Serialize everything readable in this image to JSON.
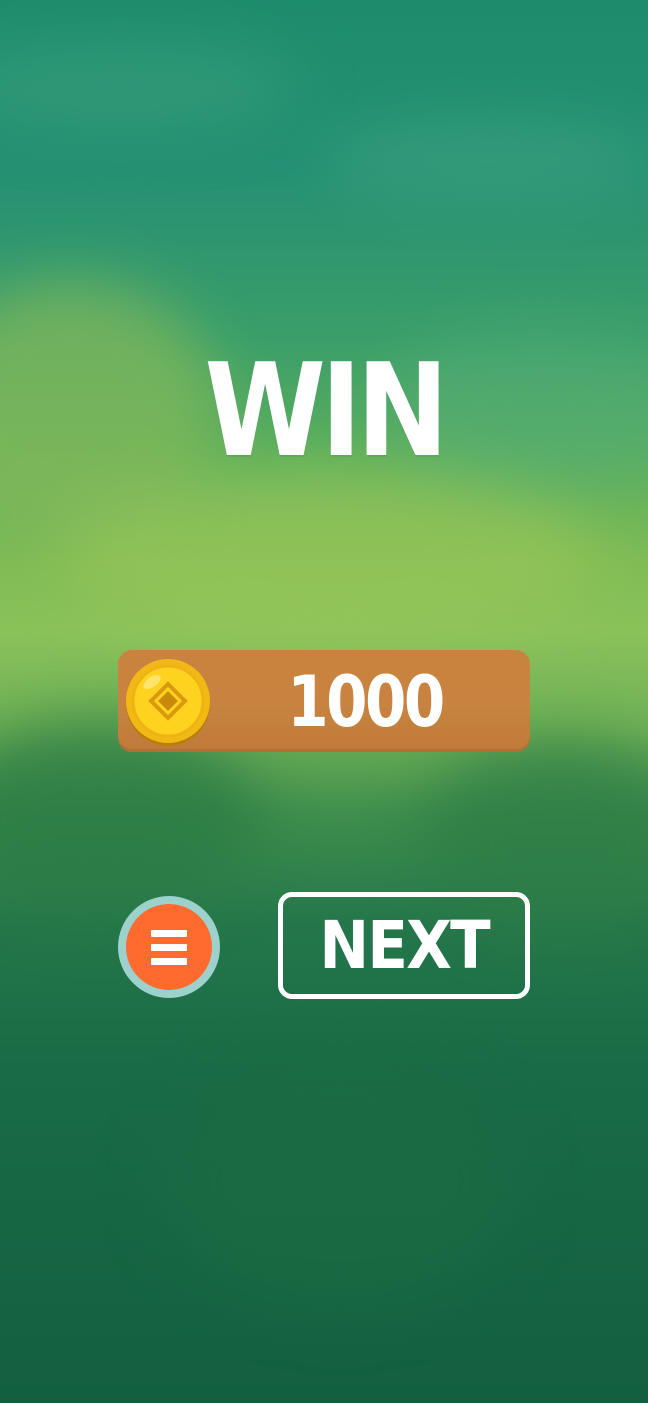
{
  "result": {
    "title": "WIN"
  },
  "reward": {
    "icon": "gold-coin-icon",
    "amount": "1000"
  },
  "actions": {
    "menu_icon": "menu-icon",
    "next_label": "NEXT"
  },
  "colors": {
    "coin_panel": "#c8843f",
    "menu_button": "#ff6a2f",
    "menu_ring": "#9dd1cc",
    "text": "#ffffff"
  }
}
